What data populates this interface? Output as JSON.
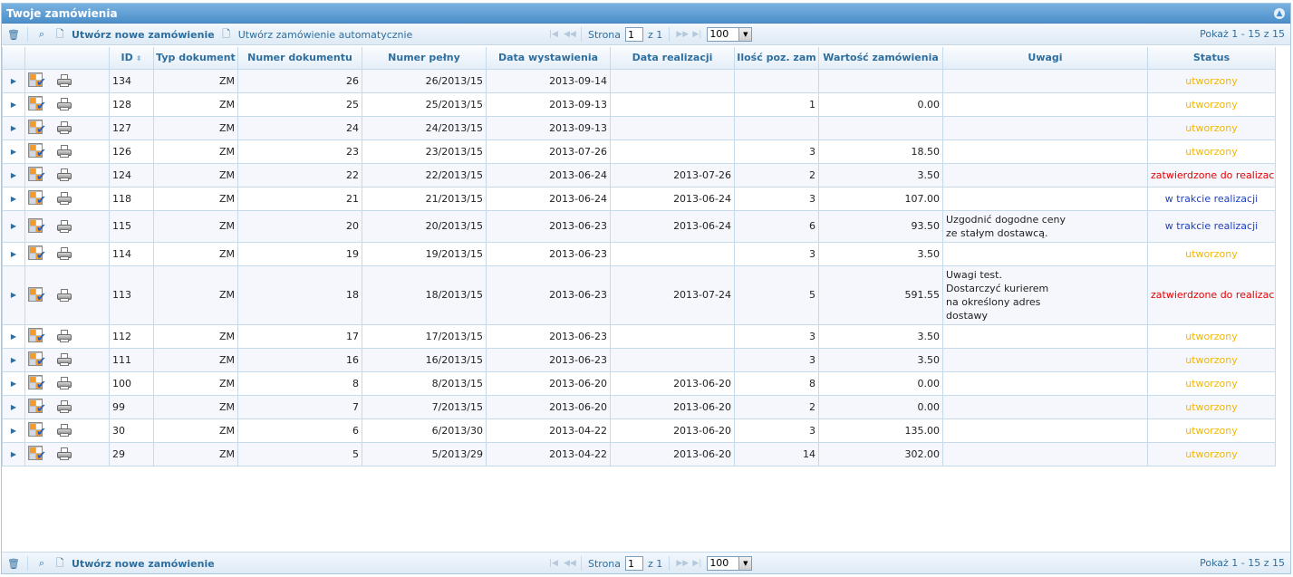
{
  "title": "Twoje zamówienia",
  "toolbar": {
    "create_label": "Utwórz nowe zamówienie",
    "auto_label": "Utwórz zamówienie automatycznie",
    "page_label": "Strona",
    "page_value": "1",
    "of_label": "z 1",
    "rows_value": "100",
    "view_text": "Pokaż 1 - 15 z 15"
  },
  "columns": [
    "",
    "",
    "ID",
    "Typ dokument",
    "Numer dokumentu",
    "Numer pełny",
    "Data wystawienia",
    "Data realizacji",
    "Ilość poz. zam",
    "Wartość zamówienia",
    "Uwagi",
    "Status"
  ],
  "rows": [
    {
      "id": "134",
      "typ": "ZM",
      "numer": "26",
      "pelny": "26/2013/15",
      "wyst": "2013-09-14",
      "real": "",
      "ilosc": "",
      "wartosc": "",
      "uwagi": [],
      "status": "utworzony",
      "status_class": "utworzony"
    },
    {
      "id": "128",
      "typ": "ZM",
      "numer": "25",
      "pelny": "25/2013/15",
      "wyst": "2013-09-13",
      "real": "",
      "ilosc": "1",
      "wartosc": "0.00",
      "uwagi": [],
      "status": "utworzony",
      "status_class": "utworzony"
    },
    {
      "id": "127",
      "typ": "ZM",
      "numer": "24",
      "pelny": "24/2013/15",
      "wyst": "2013-09-13",
      "real": "",
      "ilosc": "",
      "wartosc": "",
      "uwagi": [],
      "status": "utworzony",
      "status_class": "utworzony"
    },
    {
      "id": "126",
      "typ": "ZM",
      "numer": "23",
      "pelny": "23/2013/15",
      "wyst": "2013-07-26",
      "real": "",
      "ilosc": "3",
      "wartosc": "18.50",
      "uwagi": [],
      "status": "utworzony",
      "status_class": "utworzony"
    },
    {
      "id": "124",
      "typ": "ZM",
      "numer": "22",
      "pelny": "22/2013/15",
      "wyst": "2013-06-24",
      "real": "2013-07-26",
      "ilosc": "2",
      "wartosc": "3.50",
      "uwagi": [],
      "status": "zatwierdzone do realizac",
      "status_class": "zatw"
    },
    {
      "id": "118",
      "typ": "ZM",
      "numer": "21",
      "pelny": "21/2013/15",
      "wyst": "2013-06-24",
      "real": "2013-06-24",
      "ilosc": "3",
      "wartosc": "107.00",
      "uwagi": [],
      "status": "w trakcie realizacji",
      "status_class": "wtrakcie"
    },
    {
      "id": "115",
      "typ": "ZM",
      "numer": "20",
      "pelny": "20/2013/15",
      "wyst": "2013-06-23",
      "real": "2013-06-24",
      "ilosc": "6",
      "wartosc": "93.50",
      "uwagi": [
        "Uzgodnić dogodne ceny",
        "ze stałym dostawcą."
      ],
      "status": "w trakcie realizacji",
      "status_class": "wtrakcie"
    },
    {
      "id": "114",
      "typ": "ZM",
      "numer": "19",
      "pelny": "19/2013/15",
      "wyst": "2013-06-23",
      "real": "",
      "ilosc": "3",
      "wartosc": "3.50",
      "uwagi": [],
      "status": "utworzony",
      "status_class": "utworzony"
    },
    {
      "id": "113",
      "typ": "ZM",
      "numer": "18",
      "pelny": "18/2013/15",
      "wyst": "2013-06-23",
      "real": "2013-07-24",
      "ilosc": "5",
      "wartosc": "591.55",
      "uwagi": [
        "Uwagi test.",
        "Dostarczyć kurierem",
        "na określony adres",
        "dostawy"
      ],
      "status": "zatwierdzone do realizac",
      "status_class": "zatw"
    },
    {
      "id": "112",
      "typ": "ZM",
      "numer": "17",
      "pelny": "17/2013/15",
      "wyst": "2013-06-23",
      "real": "",
      "ilosc": "3",
      "wartosc": "3.50",
      "uwagi": [],
      "status": "utworzony",
      "status_class": "utworzony"
    },
    {
      "id": "111",
      "typ": "ZM",
      "numer": "16",
      "pelny": "16/2013/15",
      "wyst": "2013-06-23",
      "real": "",
      "ilosc": "3",
      "wartosc": "3.50",
      "uwagi": [],
      "status": "utworzony",
      "status_class": "utworzony"
    },
    {
      "id": "100",
      "typ": "ZM",
      "numer": "8",
      "pelny": "8/2013/15",
      "wyst": "2013-06-20",
      "real": "2013-06-20",
      "ilosc": "8",
      "wartosc": "0.00",
      "uwagi": [],
      "status": "utworzony",
      "status_class": "utworzony"
    },
    {
      "id": "99",
      "typ": "ZM",
      "numer": "7",
      "pelny": "7/2013/15",
      "wyst": "2013-06-20",
      "real": "2013-06-20",
      "ilosc": "2",
      "wartosc": "0.00",
      "uwagi": [],
      "status": "utworzony",
      "status_class": "utworzony"
    },
    {
      "id": "30",
      "typ": "ZM",
      "numer": "6",
      "pelny": "6/2013/30",
      "wyst": "2013-04-22",
      "real": "2013-06-20",
      "ilosc": "3",
      "wartosc": "135.00",
      "uwagi": [],
      "status": "utworzony",
      "status_class": "utworzony"
    },
    {
      "id": "29",
      "typ": "ZM",
      "numer": "5",
      "pelny": "5/2013/29",
      "wyst": "2013-04-22",
      "real": "2013-06-20",
      "ilosc": "14",
      "wartosc": "302.00",
      "uwagi": [],
      "status": "utworzony",
      "status_class": "utworzony"
    }
  ]
}
